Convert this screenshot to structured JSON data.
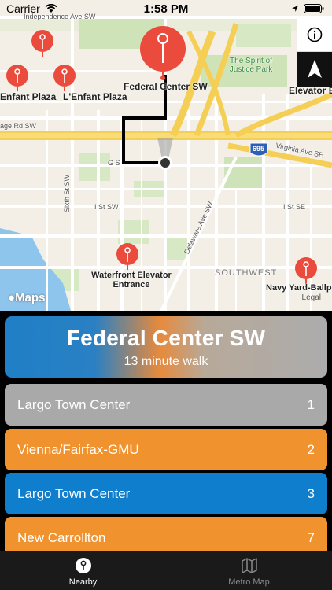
{
  "status_bar": {
    "carrier": "Carrier",
    "time": "1:58 PM"
  },
  "map": {
    "labels": {
      "independence": "Independence Ave SW",
      "lenfant_left": "Enfant Plaza",
      "lenfant": "L'Enfant Plaza",
      "federal_center": "Federal Center SW",
      "spirit": "The Spirit of Justice Park",
      "elevator_e": "Elevator E",
      "e_street": "age Rd SW",
      "virginia": "Virginia Ave SE",
      "i695": "695",
      "g_st": "G S",
      "sixth": "Sixth St SW",
      "i_st_sw": "I St SW",
      "i_st_se": "I St SE",
      "delaware": "Delaware Ave SW",
      "waterfront": "Waterfront Elevator Entrance",
      "southwest": "SOUTHWEST",
      "navy_yard": "Navy Yard-Ballp",
      "maps_logo": "Maps",
      "legal": "Legal"
    }
  },
  "destination": {
    "name": "Federal Center SW",
    "walk": "13 minute walk"
  },
  "trains": [
    {
      "destination": "Largo Town Center",
      "minutes": "1",
      "color": "#a9a9a9"
    },
    {
      "destination": "Vienna/Fairfax-GMU",
      "minutes": "2",
      "color": "#f0932f"
    },
    {
      "destination": "Largo Town Center",
      "minutes": "3",
      "color": "#0f7ecc"
    },
    {
      "destination": "New Carrollton",
      "minutes": "7",
      "color": "#f0932f"
    }
  ],
  "tabs": {
    "nearby": "Nearby",
    "metro_map": "Metro Map"
  },
  "colors": {
    "tab_active": "#ffffff",
    "tab_inactive": "#8a8a8a",
    "pin": "#ea4b3c"
  }
}
